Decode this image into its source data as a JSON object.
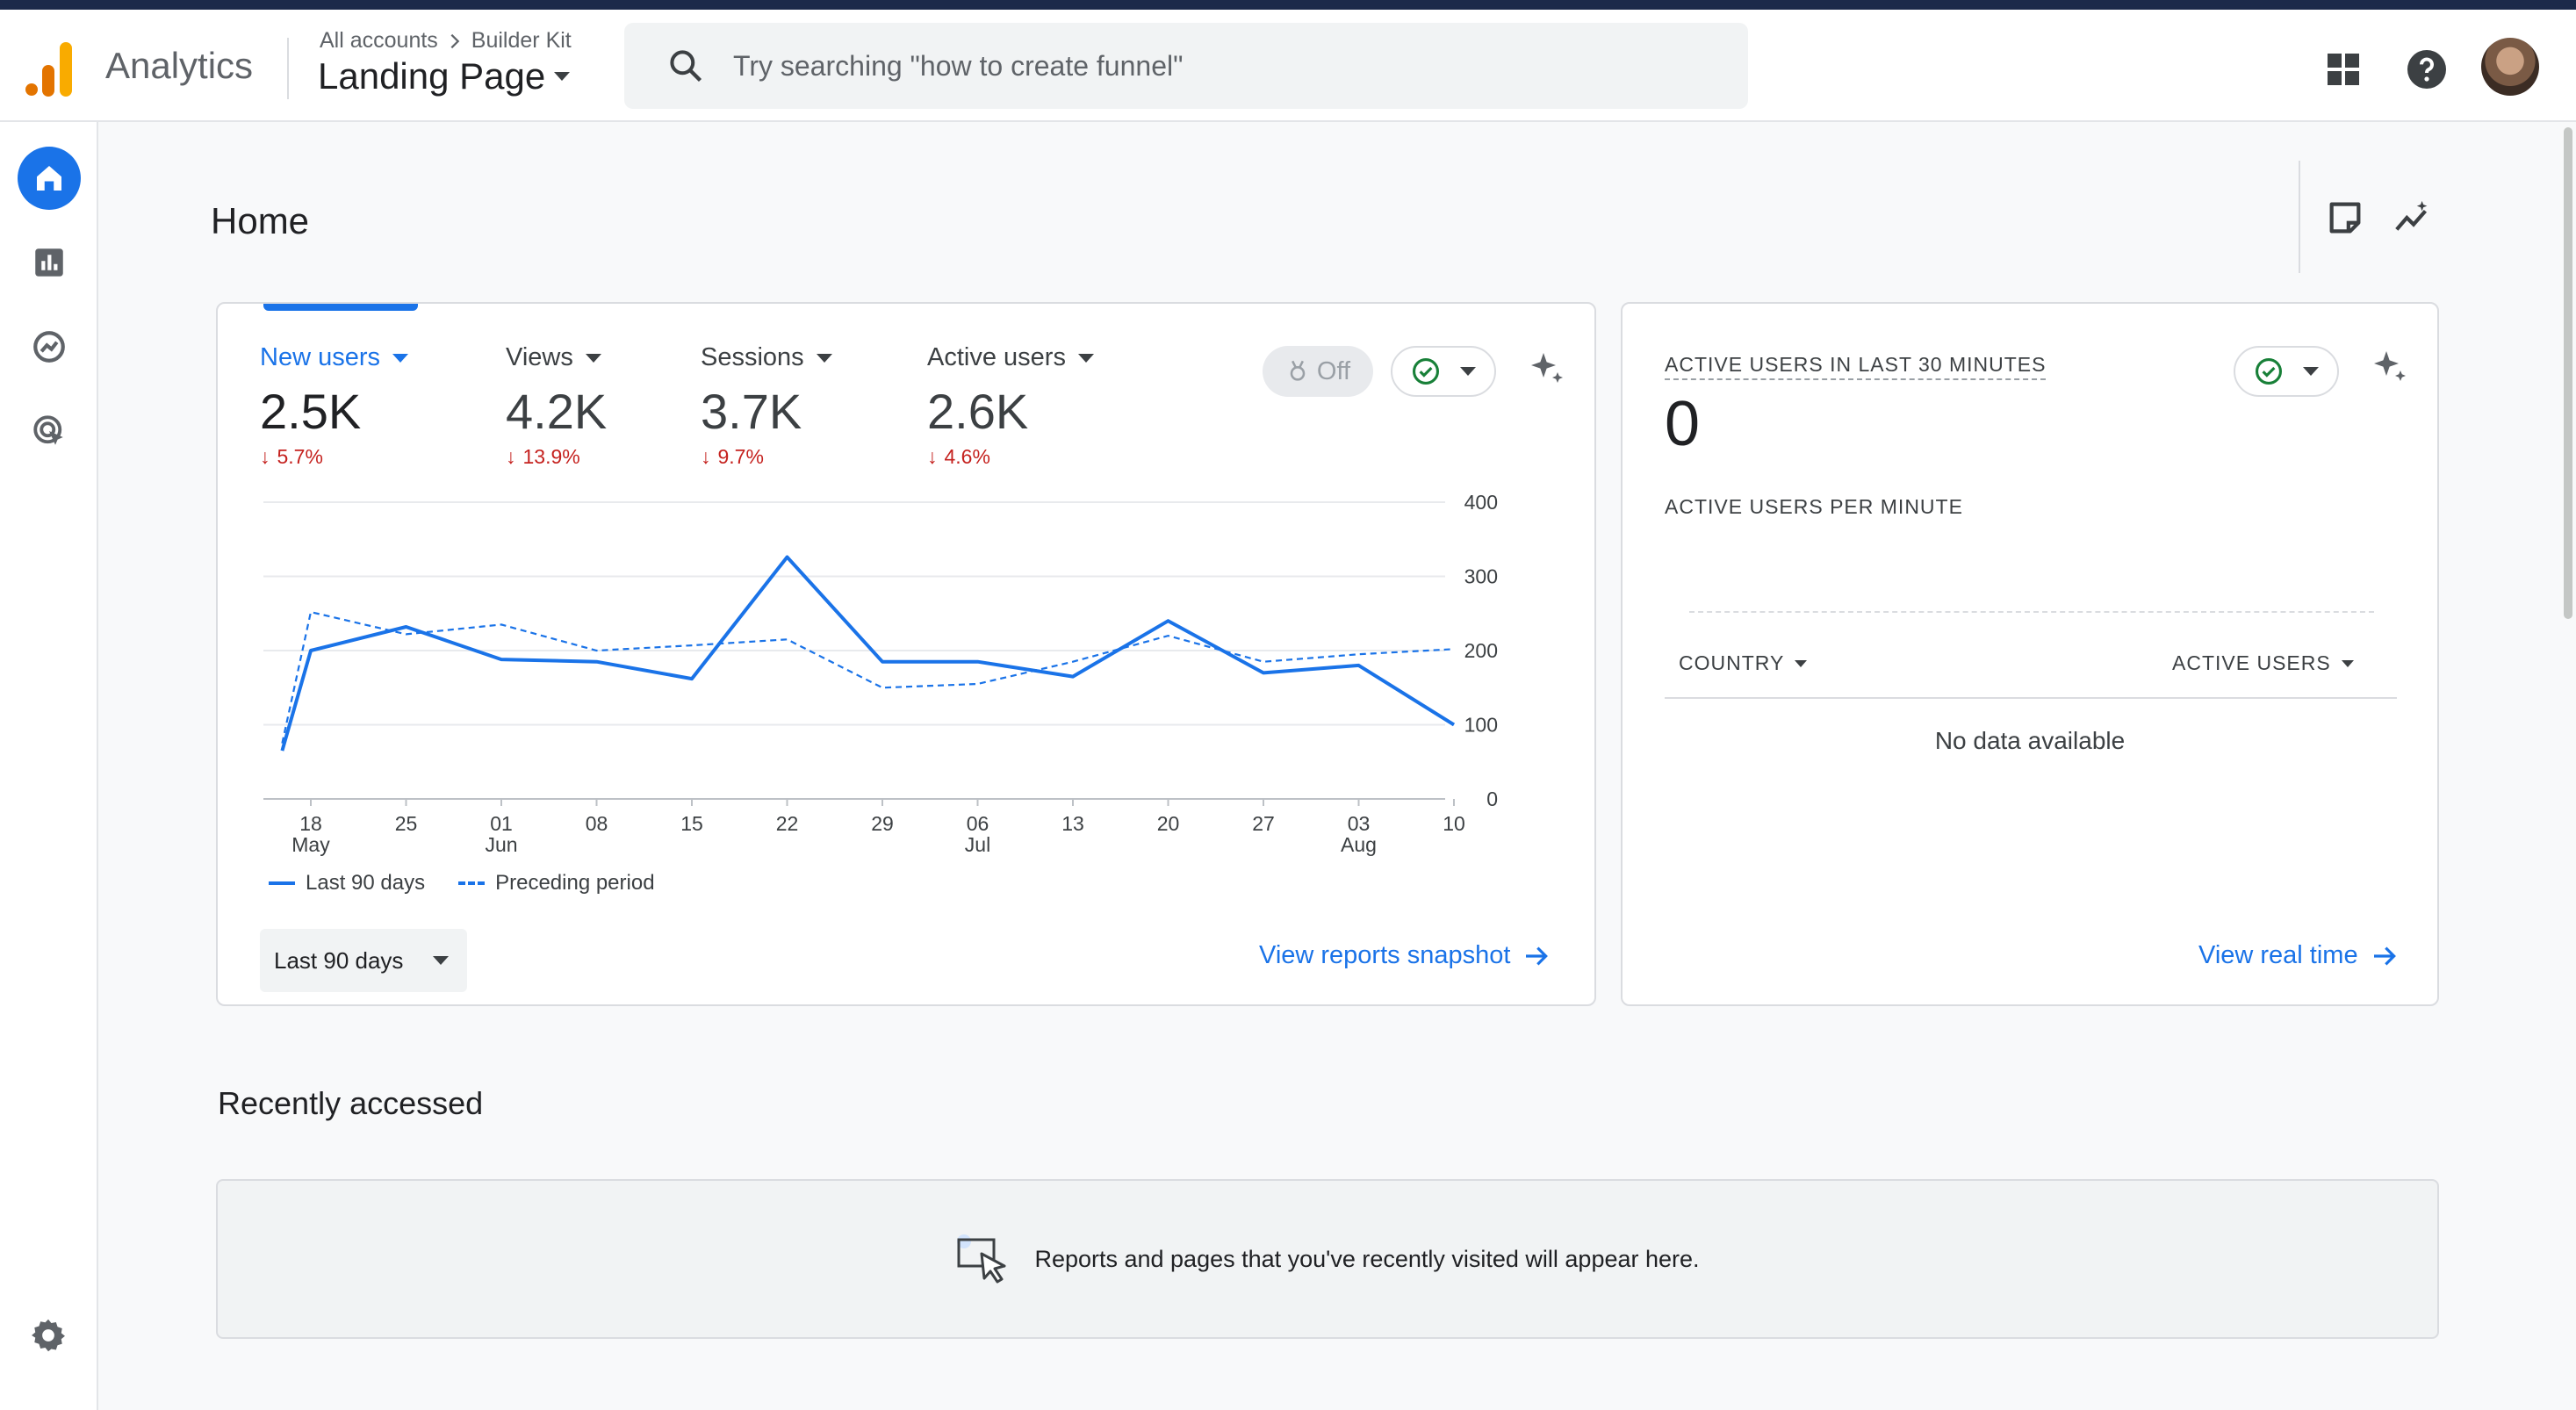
{
  "header": {
    "app_name": "Analytics",
    "breadcrumb": {
      "parent": "All accounts",
      "current": "Builder Kit"
    },
    "property": "Landing Page",
    "search_placeholder": "Try searching \"how to create funnel\"",
    "icons": [
      "apps-grid-icon",
      "help-icon",
      "avatar"
    ]
  },
  "nav": {
    "items": [
      "home-icon",
      "reports-icon",
      "explore-icon",
      "advertising-icon"
    ],
    "settings": "gear-icon",
    "active": "home-icon"
  },
  "page": {
    "title": "Home"
  },
  "metrics": [
    {
      "label": "New users",
      "value": "2.5K",
      "change": "5.7%",
      "selected": true
    },
    {
      "label": "Views",
      "value": "4.2K",
      "change": "13.9%"
    },
    {
      "label": "Sessions",
      "value": "3.7K",
      "change": "9.7%"
    },
    {
      "label": "Active users",
      "value": "2.6K",
      "change": "4.6%"
    }
  ],
  "controls": {
    "toggle_label": "Off",
    "date_range": "Last 90 days",
    "view_snapshot": "View reports snapshot"
  },
  "chart_data": {
    "type": "line",
    "y_ticks": [
      "400",
      "300",
      "200",
      "100",
      "0"
    ],
    "ylim": [
      0,
      400
    ],
    "x_ticks": [
      {
        "day": "18",
        "month": "May"
      },
      {
        "day": "25",
        "month": ""
      },
      {
        "day": "01",
        "month": "Jun"
      },
      {
        "day": "08",
        "month": ""
      },
      {
        "day": "15",
        "month": ""
      },
      {
        "day": "22",
        "month": ""
      },
      {
        "day": "29",
        "month": ""
      },
      {
        "day": "06",
        "month": "Jul"
      },
      {
        "day": "13",
        "month": ""
      },
      {
        "day": "20",
        "month": ""
      },
      {
        "day": "27",
        "month": ""
      },
      {
        "day": "03",
        "month": "Aug"
      },
      {
        "day": "10",
        "month": ""
      }
    ],
    "grid": true,
    "legend_position": "bottom-left",
    "series": [
      {
        "name": "Last 90 days",
        "style": "solid",
        "color": "#1a73e8",
        "points": [
          [
            -1.3,
            65
          ],
          [
            -1,
            200
          ],
          [
            0,
            232
          ],
          [
            1,
            188
          ],
          [
            2,
            185
          ],
          [
            3,
            162
          ],
          [
            4,
            326
          ],
          [
            5,
            185
          ],
          [
            6,
            185
          ],
          [
            7,
            165
          ],
          [
            8,
            240
          ],
          [
            9,
            170
          ],
          [
            10,
            180
          ],
          [
            11,
            100
          ]
        ]
      },
      {
        "name": "Preceding period",
        "style": "dashed",
        "color": "#1a73e8",
        "points": [
          [
            -1.3,
            75
          ],
          [
            -1,
            252
          ],
          [
            0,
            222
          ],
          [
            1,
            235
          ],
          [
            2,
            200
          ],
          [
            3,
            207
          ],
          [
            4,
            215
          ],
          [
            5,
            150
          ],
          [
            6,
            155
          ],
          [
            7,
            185
          ],
          [
            8,
            220
          ],
          [
            9,
            185
          ],
          [
            10,
            195
          ],
          [
            11,
            202
          ]
        ]
      }
    ]
  },
  "realtime": {
    "title": "ACTIVE USERS IN LAST 30 MINUTES",
    "value": "0",
    "subtitle": "ACTIVE USERS PER MINUTE",
    "col_country": "COUNTRY",
    "col_users": "ACTIVE USERS",
    "empty": "No data available",
    "link": "View real time"
  },
  "recent": {
    "title": "Recently accessed",
    "empty": "Reports and pages that you've recently visited will appear here."
  },
  "colors": {
    "accent": "#1a73e8",
    "negative": "#c5221f",
    "check": "#188038",
    "logo": "#f9ab00"
  }
}
